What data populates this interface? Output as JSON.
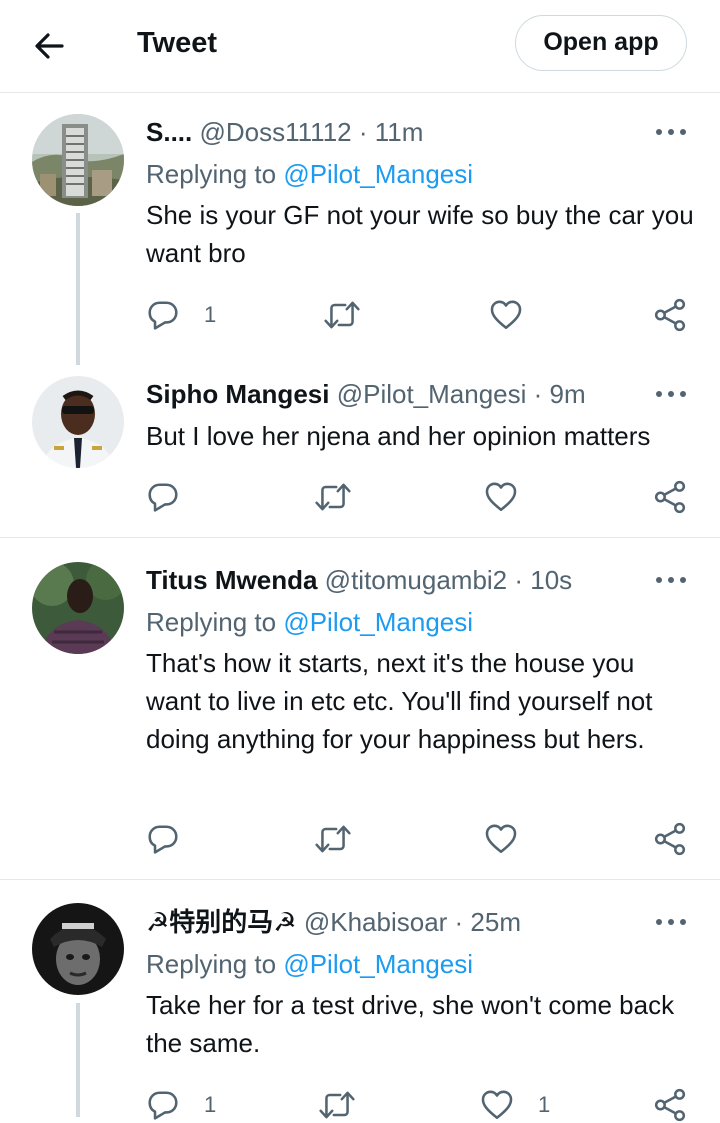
{
  "header": {
    "title": "Tweet",
    "open_app_label": "Open app"
  },
  "tweets": [
    {
      "name": "S....",
      "meta": "@Doss11112 · 11m",
      "reply_prefix": "Replying to",
      "reply_handle": "@Pilot_Mangesi",
      "text": "She is your GF not your wife so buy the car you want bro",
      "reply_count": "1",
      "like_count": ""
    },
    {
      "name": "Sipho Mangesi",
      "meta": "@Pilot_Mangesi · 9m",
      "text": "But I love her njena and her opinion matters",
      "reply_count": "",
      "like_count": ""
    },
    {
      "name": "Titus Mwenda",
      "meta": "@titomugambi2 · 10s",
      "reply_prefix": "Replying to",
      "reply_handle": "@Pilot_Mangesi",
      "text": "That's how it starts, next it's the house you want to live in etc etc. You'll find yourself not doing anything for your happiness but hers.",
      "reply_count": "",
      "like_count": ""
    },
    {
      "name": "☭特别的马☭",
      "meta": "@Khabisoar · 25m",
      "reply_prefix": "Replying to",
      "reply_handle": "@Pilot_Mangesi",
      "text": "Take her for a test drive, she won't come back the same.",
      "reply_count": "1",
      "like_count": "1"
    }
  ],
  "icons": {
    "back": "arrow-left-icon",
    "more": "more-dots-icon",
    "reply": "reply-bubble-icon",
    "retweet": "retweet-icon",
    "like": "heart-icon",
    "share": "share-icon"
  },
  "colors": {
    "link": "#1d9bf0",
    "muted": "#536471",
    "text": "#0f1419",
    "divider": "#e6e9eb"
  }
}
